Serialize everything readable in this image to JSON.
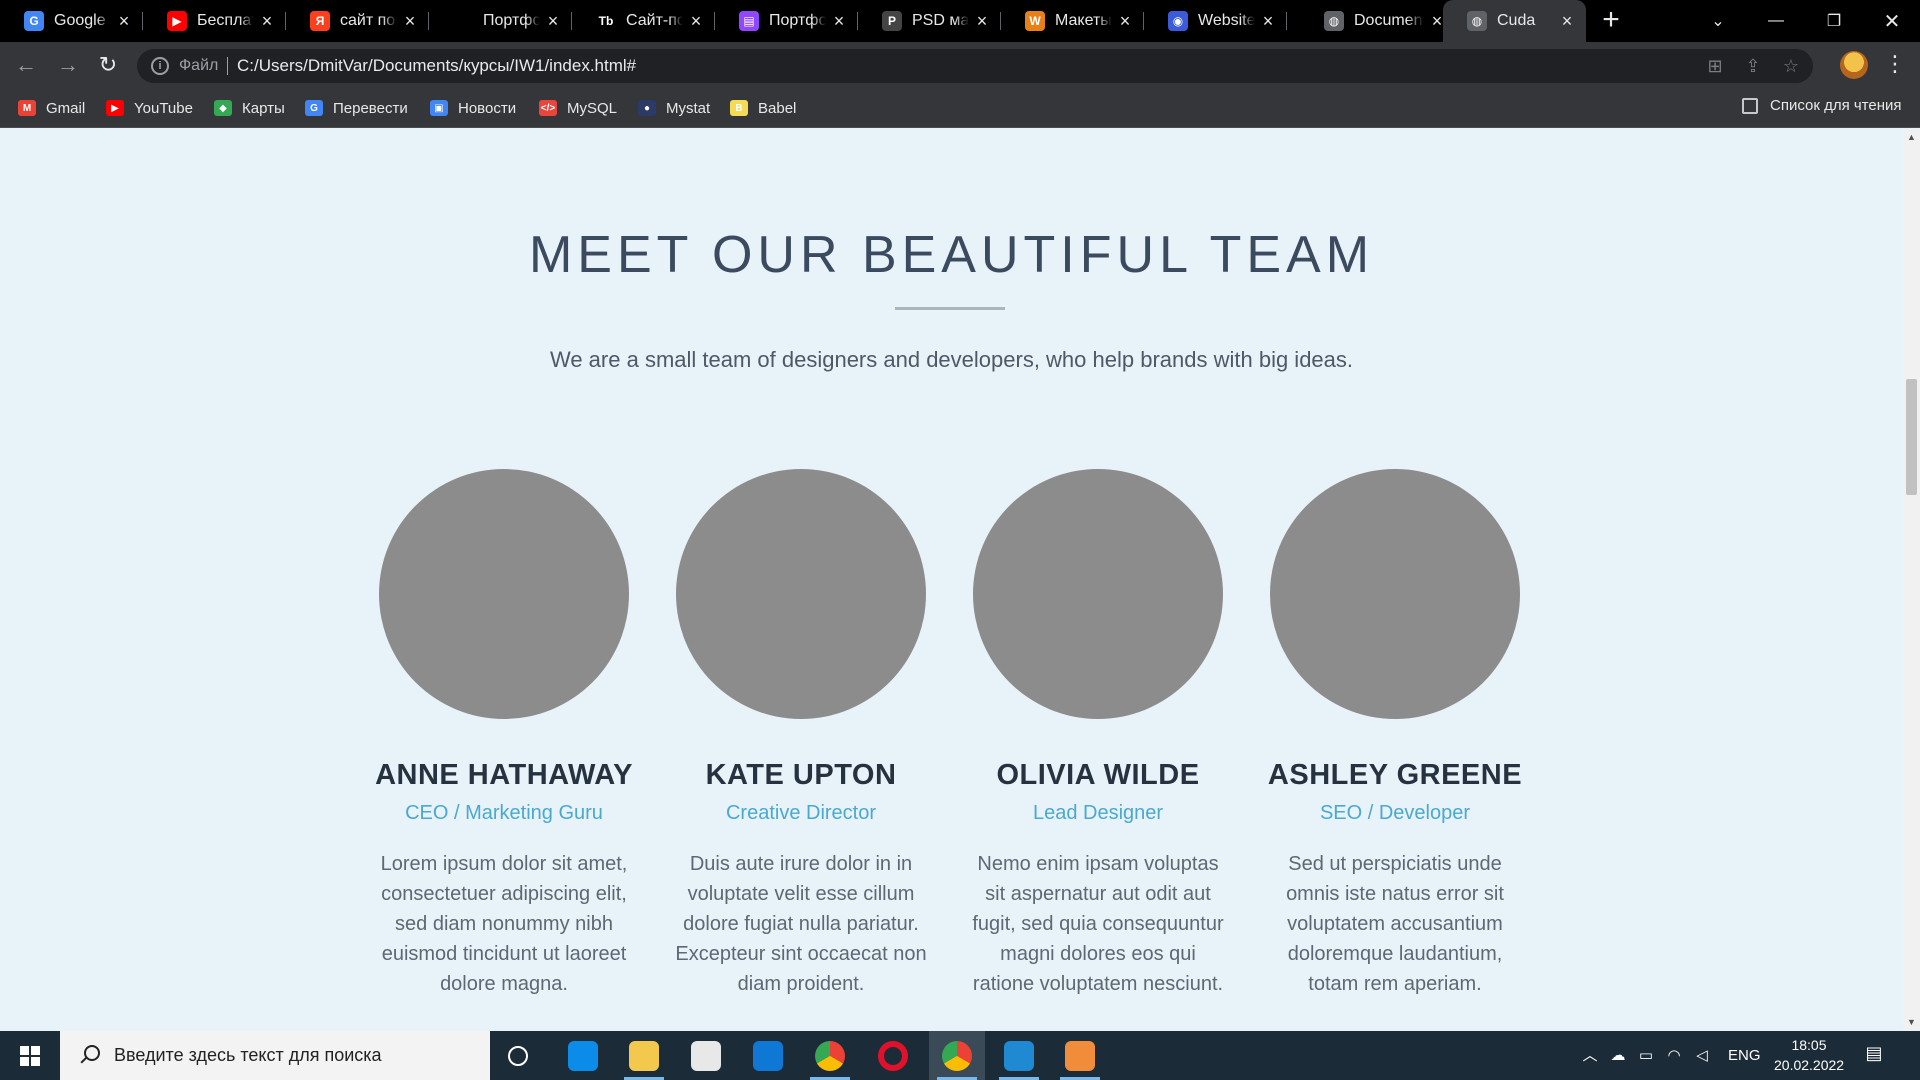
{
  "browser": {
    "tabs": [
      {
        "title": "Google Переводчик",
        "icon": "google-translate-icon",
        "color": "#4285f4",
        "glyph": "G"
      },
      {
        "title": "Бесплатные",
        "icon": "youtube-icon",
        "color": "#ff0000",
        "glyph": "▶"
      },
      {
        "title": "сайт портфолио",
        "icon": "yandex-icon",
        "color": "#fc3f1d",
        "glyph": "Я"
      },
      {
        "title": "Портфолио",
        "icon": "blank-page-icon",
        "color": "#000000",
        "glyph": ""
      },
      {
        "title": "Сайт-портфолио",
        "icon": "tb-icon",
        "color": "#000000",
        "glyph": "Tb"
      },
      {
        "title": "Портфолио",
        "icon": "twitch-icon",
        "color": "#9146ff",
        "glyph": "▤"
      },
      {
        "title": "PSD макеты",
        "icon": "psd-icon",
        "color": "#444444",
        "glyph": "P"
      },
      {
        "title": "Макеты сайтов",
        "icon": "w-icon",
        "color": "#e8801a",
        "glyph": "W"
      },
      {
        "title": "Website Portfolio",
        "icon": "robot-icon",
        "color": "#3b5bdb",
        "glyph": "◉"
      },
      {
        "title": "Document",
        "icon": "globe-icon",
        "color": "#5f6368",
        "glyph": "◍"
      },
      {
        "title": "Cuda",
        "icon": "globe-icon",
        "color": "#5f6368",
        "glyph": "◍",
        "active": true
      }
    ],
    "address": {
      "protocol_label": "Файл",
      "url": "C:/Users/DmitVar/Documents/курсы/IW1/index.html#"
    },
    "bookmarks": [
      {
        "label": "Gmail",
        "icon": "gmail-icon",
        "color": "#ea4335",
        "glyph": "M"
      },
      {
        "label": "YouTube",
        "icon": "youtube-icon",
        "color": "#ff0000",
        "glyph": "▶"
      },
      {
        "label": "Карты",
        "icon": "maps-icon",
        "color": "#34a853",
        "glyph": "◆"
      },
      {
        "label": "Перевести",
        "icon": "google-translate-icon",
        "color": "#4285f4",
        "glyph": "G"
      },
      {
        "label": "Новости",
        "icon": "news-icon",
        "color": "#4285f4",
        "glyph": "▣"
      },
      {
        "label": "MySQL",
        "icon": "code-icon",
        "color": "#e8453c",
        "glyph": "</>"
      },
      {
        "label": "Mystat",
        "icon": "mystat-icon",
        "color": "#2b3a67",
        "glyph": "●"
      },
      {
        "label": "Babel",
        "icon": "babel-icon",
        "color": "#f5da55",
        "glyph": "B"
      }
    ],
    "reading_list_label": "Список для чтения"
  },
  "page": {
    "section_title": "MEET OUR BEAUTIFUL TEAM",
    "section_subtitle": "We are a small team of designers and developers, who help brands with big ideas.",
    "team": [
      {
        "name": "ANNE HATHAWAY",
        "role": "CEO / Marketing Guru",
        "description": "Lorem ipsum dolor sit amet, consectetuer adipiscing elit, sed diam nonummy nibh euismod tincidunt ut laoreet dolore magna."
      },
      {
        "name": "KATE UPTON",
        "role": "Creative Director",
        "description": "Duis aute irure dolor in in voluptate velit esse cillum dolore fugiat nulla pariatur. Excepteur sint occaecat non diam proident."
      },
      {
        "name": "OLIVIA WILDE",
        "role": "Lead Designer",
        "description": "Nemo enim ipsam voluptas sit aspernatur aut odit aut fugit, sed quia consequuntur magni dolores eos qui ratione voluptatem nesciunt."
      },
      {
        "name": "ASHLEY GREENE",
        "role": "SEO / Developer",
        "description": "Sed ut perspiciatis unde omnis iste natus error sit voluptatem accusantium doloremque laudantium, totam rem aperiam."
      }
    ],
    "colors": {
      "background": "#e8f2f9",
      "avatar": "#8c8c8c",
      "role_accent": "#4aa9d0",
      "heading": "#26323f"
    }
  },
  "taskbar": {
    "search_placeholder": "Введите здесь текст для поиска",
    "apps": [
      {
        "name": "task-view-icon",
        "color": "#1c2b38"
      },
      {
        "name": "edge-icon",
        "color": "#0c8ce9"
      },
      {
        "name": "file-explorer-icon",
        "color": "#f2c94c"
      },
      {
        "name": "microsoft-store-icon",
        "color": "#e8e8e8"
      },
      {
        "name": "mail-icon",
        "color": "#0f78d4"
      },
      {
        "name": "chrome-icon",
        "color": "#34a853"
      },
      {
        "name": "opera-icon",
        "color": "#e0112b"
      },
      {
        "name": "chrome-icon",
        "color": "#34a853"
      },
      {
        "name": "vscode-icon",
        "color": "#1f8ad2"
      },
      {
        "name": "paint-app-icon",
        "color": "#f08c3a"
      }
    ],
    "language": "ENG",
    "time": "18:05",
    "date": "20.02.2022"
  }
}
